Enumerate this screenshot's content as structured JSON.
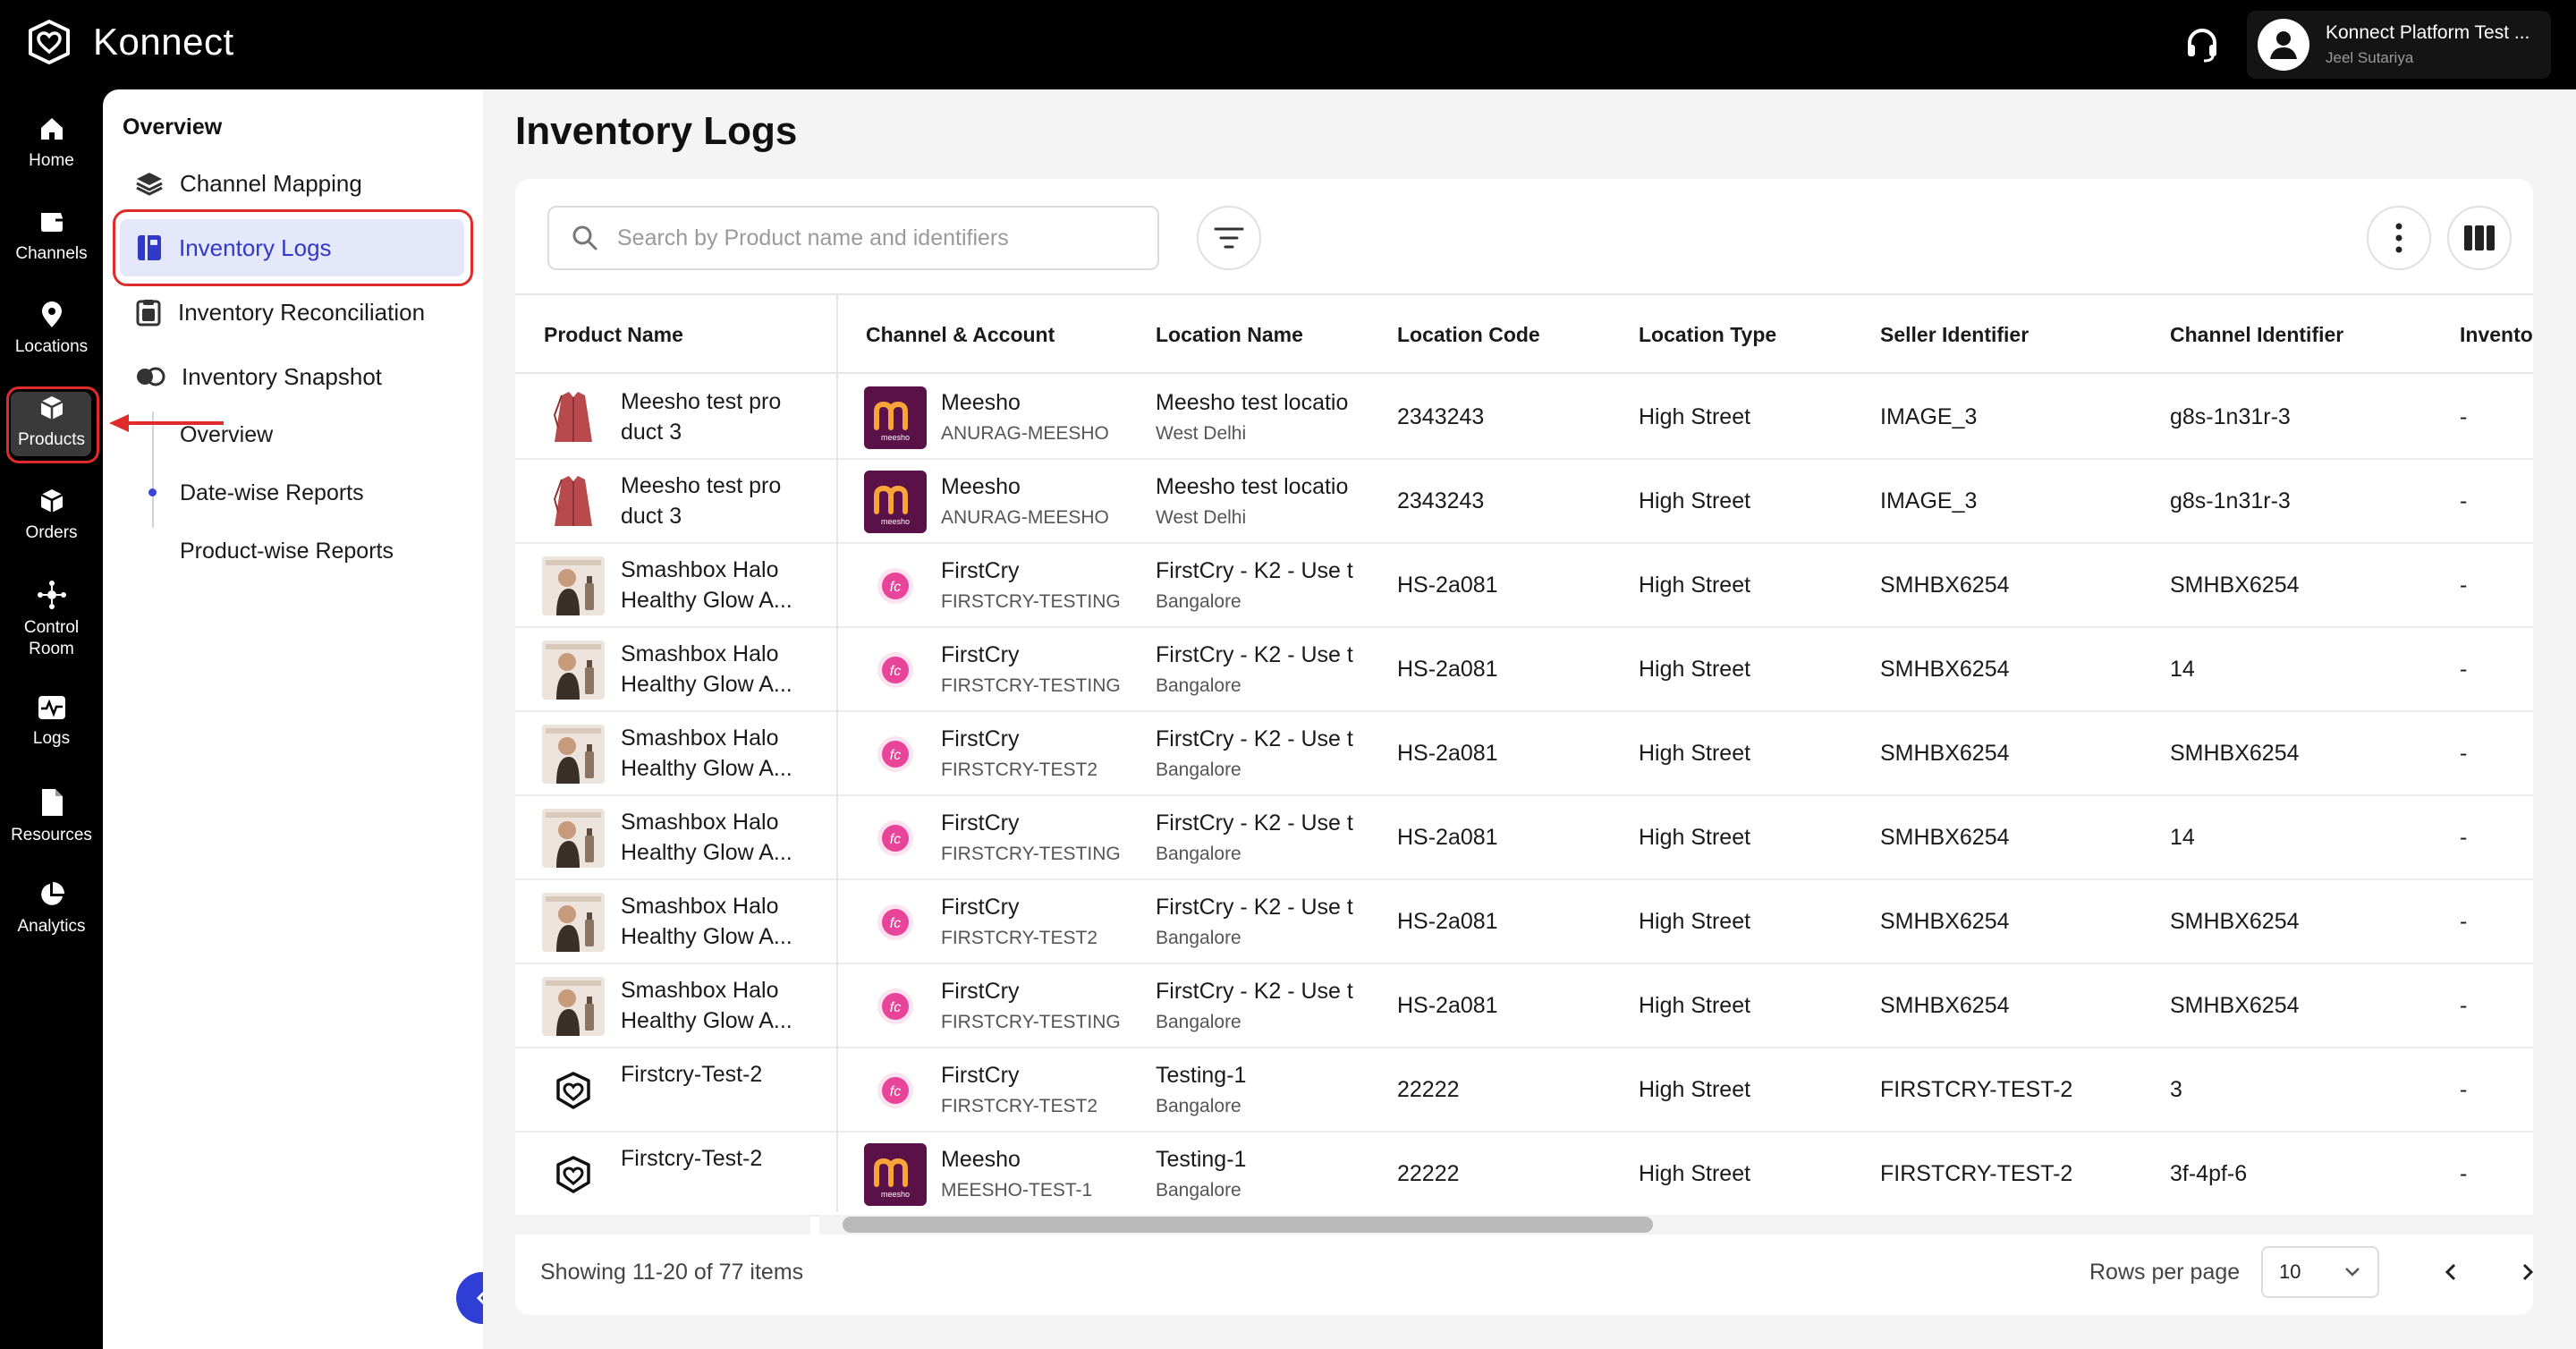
{
  "app": {
    "brand": "Konnect"
  },
  "account": {
    "name": "Konnect Platform Test ...",
    "user": "Jeel Sutariya"
  },
  "rail": [
    {
      "label": "Home",
      "icon": "home-icon"
    },
    {
      "label": "Channels",
      "icon": "channels-icon"
    },
    {
      "label": "Locations",
      "icon": "location-pin-icon"
    },
    {
      "label": "Products",
      "icon": "box-icon",
      "active": true
    },
    {
      "label": "Orders",
      "icon": "package-icon"
    },
    {
      "label": "Control\nRoom",
      "icon": "control-room-icon"
    },
    {
      "label": "Logs",
      "icon": "logs-icon"
    },
    {
      "label": "Resources",
      "icon": "document-icon"
    },
    {
      "label": "Analytics",
      "icon": "pie-chart-icon"
    }
  ],
  "subnav": {
    "title": "Overview",
    "items": [
      {
        "label": "Channel Mapping",
        "icon": "layers-icon"
      },
      {
        "label": "Inventory Logs",
        "icon": "book-icon",
        "active": true
      },
      {
        "label": "Inventory Reconciliation",
        "icon": "clipboard-icon"
      },
      {
        "label": "Inventory Snapshot",
        "icon": "snapshot-icon"
      }
    ],
    "children": [
      "Overview",
      "Date-wise Reports",
      "Product-wise Reports"
    ]
  },
  "page": {
    "title": "Inventory Logs"
  },
  "search": {
    "placeholder": "Search by Product name and identifiers"
  },
  "columns": [
    "Product Name",
    "Channel & Account",
    "Location Name",
    "Location Code",
    "Location Type",
    "Seller Identifier",
    "Channel Identifier",
    "Inventor"
  ],
  "rows": [
    {
      "product": "Meesho test pro duct 3",
      "thumb": "jacket",
      "channel": "Meesho",
      "account": "ANURAG-MEESHO",
      "logo": "meesho",
      "location": "Meesho test locatio",
      "city": "West Delhi",
      "code": "2343243",
      "type": "High Street",
      "seller": "IMAGE_3",
      "chid": "g8s-1n31r-3",
      "inv": "-"
    },
    {
      "product": "Meesho test pro duct 3",
      "thumb": "jacket",
      "channel": "Meesho",
      "account": "ANURAG-MEESHO",
      "logo": "meesho",
      "location": "Meesho test locatio",
      "city": "West Delhi",
      "code": "2343243",
      "type": "High Street",
      "seller": "IMAGE_3",
      "chid": "g8s-1n31r-3",
      "inv": "-"
    },
    {
      "product": "Smashbox Halo Healthy Glow A...",
      "thumb": "cosmetic",
      "channel": "FirstCry",
      "account": "FIRSTCRY-TESTING",
      "logo": "firstcry",
      "location": "FirstCry - K2 - Use t",
      "city": "Bangalore",
      "code": "HS-2a081",
      "type": "High Street",
      "seller": "SMHBX6254",
      "chid": "SMHBX6254",
      "inv": "-"
    },
    {
      "product": "Smashbox Halo Healthy Glow A...",
      "thumb": "cosmetic",
      "channel": "FirstCry",
      "account": "FIRSTCRY-TESTING",
      "logo": "firstcry",
      "location": "FirstCry - K2 - Use t",
      "city": "Bangalore",
      "code": "HS-2a081",
      "type": "High Street",
      "seller": "SMHBX6254",
      "chid": "14",
      "inv": "-"
    },
    {
      "product": "Smashbox Halo Healthy Glow A...",
      "thumb": "cosmetic",
      "channel": "FirstCry",
      "account": "FIRSTCRY-TEST2",
      "logo": "firstcry",
      "location": "FirstCry - K2 - Use t",
      "city": "Bangalore",
      "code": "HS-2a081",
      "type": "High Street",
      "seller": "SMHBX6254",
      "chid": "SMHBX6254",
      "inv": "-"
    },
    {
      "product": "Smashbox Halo Healthy Glow A...",
      "thumb": "cosmetic",
      "channel": "FirstCry",
      "account": "FIRSTCRY-TESTING",
      "logo": "firstcry",
      "location": "FirstCry - K2 - Use t",
      "city": "Bangalore",
      "code": "HS-2a081",
      "type": "High Street",
      "seller": "SMHBX6254",
      "chid": "14",
      "inv": "-"
    },
    {
      "product": "Smashbox Halo Healthy Glow A...",
      "thumb": "cosmetic",
      "channel": "FirstCry",
      "account": "FIRSTCRY-TEST2",
      "logo": "firstcry",
      "location": "FirstCry - K2 - Use t",
      "city": "Bangalore",
      "code": "HS-2a081",
      "type": "High Street",
      "seller": "SMHBX6254",
      "chid": "SMHBX6254",
      "inv": "-"
    },
    {
      "product": "Smashbox Halo Healthy Glow A...",
      "thumb": "cosmetic",
      "channel": "FirstCry",
      "account": "FIRSTCRY-TESTING",
      "logo": "firstcry",
      "location": "FirstCry - K2 - Use t",
      "city": "Bangalore",
      "code": "HS-2a081",
      "type": "High Street",
      "seller": "SMHBX6254",
      "chid": "SMHBX6254",
      "inv": "-"
    },
    {
      "product": "Firstcry-Test-2",
      "thumb": "konnect",
      "channel": "FirstCry",
      "account": "FIRSTCRY-TEST2",
      "logo": "firstcry",
      "location": "Testing-1",
      "city": "Bangalore",
      "code": "22222",
      "type": "High Street",
      "seller": "FIRSTCRY-TEST-2",
      "chid": "3",
      "inv": "-"
    },
    {
      "product": "Firstcry-Test-2",
      "thumb": "konnect",
      "channel": "Meesho",
      "account": "MEESHO-TEST-1",
      "logo": "meesho",
      "location": "Testing-1",
      "city": "Bangalore",
      "code": "22222",
      "type": "High Street",
      "seller": "FIRSTCRY-TEST-2",
      "chid": "3f-4pf-6",
      "inv": "-"
    }
  ],
  "footer": {
    "showing": "Showing 11-20 of 77 items",
    "rows_per_page_label": "Rows per page",
    "rows_per_page": "10"
  },
  "colors": {
    "accent": "#3139c8",
    "highlight": "#e02b2b",
    "meesho": "#5a1147",
    "firstcry": "#e8449a"
  }
}
